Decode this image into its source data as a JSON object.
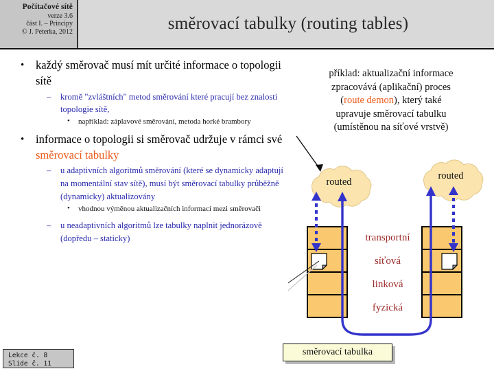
{
  "header": {
    "course_title": "Počítačové sítě",
    "version": "verze 3.6",
    "part": "část I.  –  Principy",
    "copyright": "© J. Peterka, 2012",
    "slide_title": "směrovací  tabulky (routing tables)"
  },
  "content": {
    "bullet1": {
      "text": "každý směrovač musí mít určité informace o topologii  sítě",
      "sub1": {
        "text": "kromě \"zvláštních\"  metod směrování které pracují  bez znalosti  topologie  sítě,",
        "sub1": {
          "text": "například: záplavové  směrování, metoda horké brambory"
        }
      }
    },
    "bullet2": {
      "text_before": "informace o topologii  si směrovač udržuje v rámci své ",
      "highlight": "směrovací tabulky",
      "sub1": {
        "text": "u adaptivních  algoritmů  směrování (které se dynamicky  adaptují na momentální  stav sítě), musí  být směrovací  tabulky  průběžně  (dynamicky)  aktualizovány",
        "sub1": {
          "text": "vhodnou výměnou aktualizačních informací mezi směrovači"
        }
      },
      "sub2": {
        "text": "u neadaptivních  algoritmů  lze tabulky naplnit jednorázově  (dopředu – staticky)"
      }
    }
  },
  "right_note": {
    "line1": "příklad: aktualizační informace",
    "line2": "zpracovává (aplikační) proces",
    "line3_before": "(",
    "line3_highlight": "route demon",
    "line3_after": "), který také",
    "line4": "upravuje směrovací tabulku",
    "line5": "(umístěnou na síťové vrstvě)"
  },
  "diagram": {
    "cloud_left_label": "routed",
    "cloud_right_label": "routed",
    "layers": [
      "transportní",
      "síťová",
      "linková",
      "fyzická"
    ],
    "table_label": "směrovací tabulka",
    "colors": {
      "cloud_fill": "#fbe4ae",
      "layer_fill": "#fac86e",
      "arrow_blue": "#3333cc",
      "layer_text": "#9e2b2b",
      "accent_orange": "#ec5c1b"
    }
  },
  "footer": {
    "lecture": "Lekce č. 8",
    "slide": "Slide č. 11"
  }
}
